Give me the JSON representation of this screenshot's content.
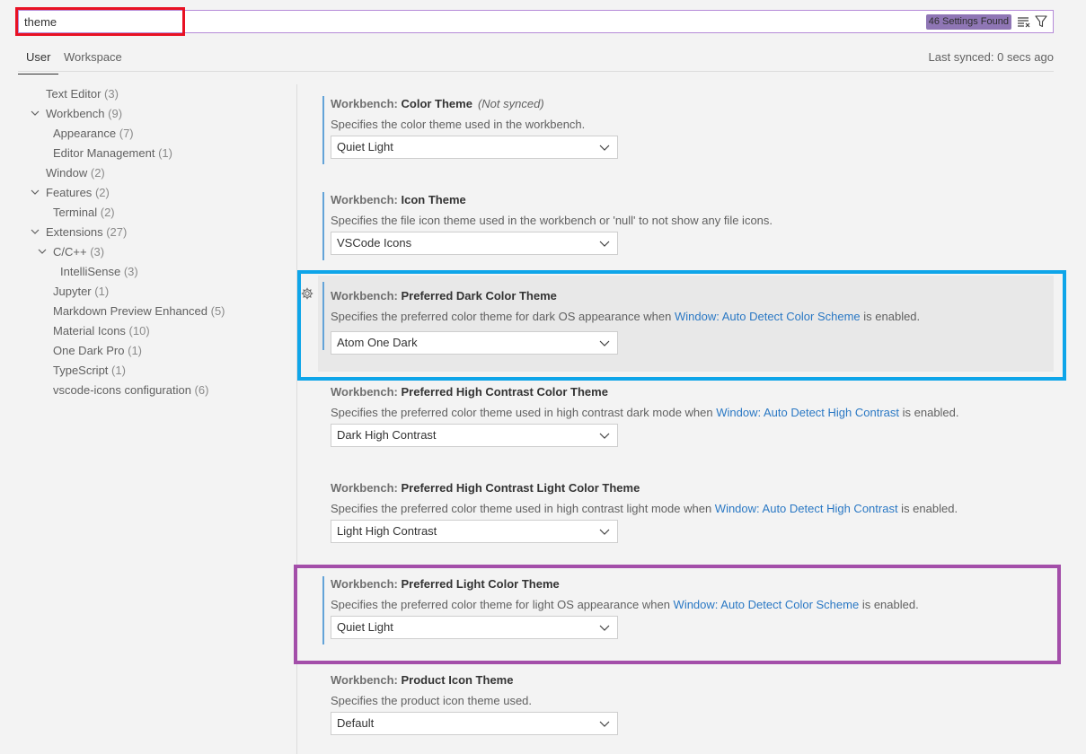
{
  "search": {
    "value": "theme",
    "found_label": "46 Settings Found"
  },
  "icons": {
    "clear": "clear-filter-icon",
    "filter": "filter-icon",
    "gear": "gear-icon",
    "chevron": "chevron-down-icon"
  },
  "tabs": {
    "user": "User",
    "workspace": "Workspace",
    "last_synced": "Last synced: 0 secs ago"
  },
  "toc": [
    {
      "label": "Text Editor",
      "count": "(3)"
    },
    {
      "label": "Workbench",
      "count": "(9)"
    },
    {
      "label": "Appearance",
      "count": "(7)"
    },
    {
      "label": "Editor Management",
      "count": "(1)"
    },
    {
      "label": "Window",
      "count": "(2)"
    },
    {
      "label": "Features",
      "count": "(2)"
    },
    {
      "label": "Terminal",
      "count": "(2)"
    },
    {
      "label": "Extensions",
      "count": "(27)"
    },
    {
      "label": "C/C++",
      "count": "(3)"
    },
    {
      "label": "IntelliSense",
      "count": "(3)"
    },
    {
      "label": "Jupyter",
      "count": "(1)"
    },
    {
      "label": "Markdown Preview Enhanced",
      "count": "(5)"
    },
    {
      "label": "Material Icons",
      "count": "(10)"
    },
    {
      "label": "One Dark Pro",
      "count": "(1)"
    },
    {
      "label": "TypeScript",
      "count": "(1)"
    },
    {
      "label": "vscode-icons configuration",
      "count": "(6)"
    }
  ],
  "settings": [
    {
      "category": "Workbench: ",
      "name": "Color Theme",
      "note": "(Not synced)",
      "desc_pre": "Specifies the color theme used in the workbench.",
      "link": "",
      "desc_post": "",
      "value": "Quiet Light"
    },
    {
      "category": "Workbench: ",
      "name": "Icon Theme",
      "note": "",
      "desc_pre": "Specifies the file icon theme used in the workbench or 'null' to not show any file icons.",
      "link": "",
      "desc_post": "",
      "value": "VSCode Icons"
    },
    {
      "category": "Workbench: ",
      "name": "Preferred Dark Color Theme",
      "note": "",
      "desc_pre": "Specifies the preferred color theme for dark OS appearance when ",
      "link": "Window: Auto Detect Color Scheme",
      "desc_post": " is enabled.",
      "value": "Atom One Dark"
    },
    {
      "category": "Workbench: ",
      "name": "Preferred High Contrast Color Theme",
      "note": "",
      "desc_pre": "Specifies the preferred color theme used in high contrast dark mode when ",
      "link": "Window: Auto Detect High Contrast",
      "desc_post": " is enabled.",
      "value": "Dark High Contrast"
    },
    {
      "category": "Workbench: ",
      "name": "Preferred High Contrast Light Color Theme",
      "note": "",
      "desc_pre": "Specifies the preferred color theme used in high contrast light mode when ",
      "link": "Window: Auto Detect High Contrast",
      "desc_post": " is enabled.",
      "value": "Light High Contrast"
    },
    {
      "category": "Workbench: ",
      "name": "Preferred Light Color Theme",
      "note": "",
      "desc_pre": "Specifies the preferred color theme for light OS appearance when ",
      "link": "Window: Auto Detect Color Scheme",
      "desc_post": " is enabled.",
      "value": "Quiet Light"
    },
    {
      "category": "Workbench: ",
      "name": "Product Icon Theme",
      "note": "",
      "desc_pre": "Specifies the product icon theme used.",
      "link": "",
      "desc_post": "",
      "value": "Default"
    }
  ]
}
